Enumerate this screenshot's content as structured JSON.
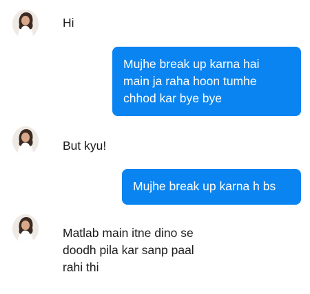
{
  "conversation": {
    "messages": [
      {
        "sender": "contact",
        "lines": [
          "Hi"
        ]
      },
      {
        "sender": "me",
        "lines": [
          "Mujhe break up karna hai",
          "main ja raha hoon tumhe",
          "chhod kar bye bye"
        ]
      },
      {
        "sender": "contact",
        "lines": [
          "But kyu!"
        ]
      },
      {
        "sender": "me",
        "lines": [
          "Mujhe break up karna h bs"
        ]
      },
      {
        "sender": "contact",
        "lines": [
          "Matlab main itne dino se",
          "doodh pila kar sanp paal",
          "rahi thi"
        ]
      }
    ]
  },
  "colors": {
    "outgoing_bubble": "#0a84f0",
    "outgoing_text": "#ffffff",
    "incoming_text": "#1b1b1b",
    "background": "#ffffff"
  },
  "icons": {
    "avatar": "contact-avatar-photo"
  }
}
